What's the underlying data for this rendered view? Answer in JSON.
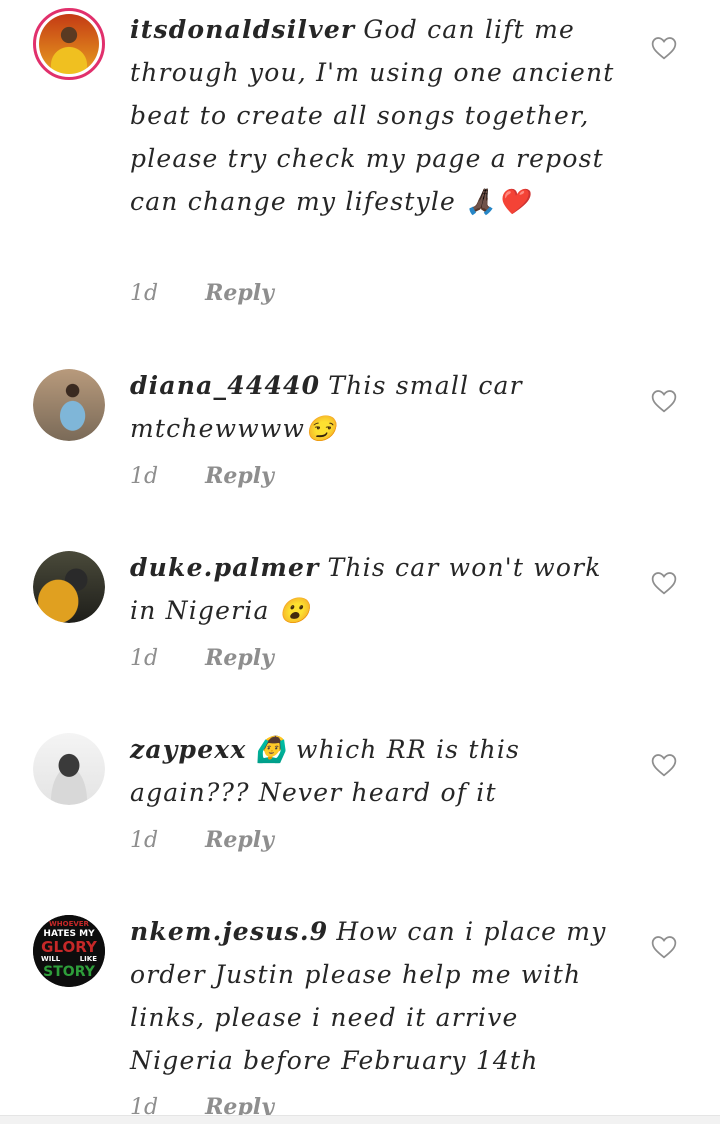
{
  "comments": [
    {
      "username": "itsdonaldsilver",
      "text": "God can lift me through you, I'm using one ancient beat to create all songs together, please try check my page a repost can change my lifestyle 🙏🏿❤️",
      "time": "1d",
      "reply": "Reply"
    },
    {
      "username": "diana_44440",
      "text": "This small car mtchewwww😏",
      "time": "1d",
      "reply": "Reply"
    },
    {
      "username": "duke.palmer",
      "text": "This car won't work in Nigeria 😮",
      "time": "1d",
      "reply": "Reply"
    },
    {
      "username": "zaypexx",
      "text": "🙆‍♂️ which RR is this again??? Never heard of it",
      "time": "1d",
      "reply": "Reply"
    },
    {
      "username": "nkem.jesus.9",
      "text": "How can i place my order Justin please help me with links, please i need it arrive Nigeria before February 14th",
      "time": "1d",
      "reply": "Reply"
    }
  ],
  "avatars": {
    "nkem_text": [
      "WHOEVER",
      "HATES MY",
      "GLORY",
      "WILL",
      "LIKE",
      "STORY"
    ]
  },
  "colors": {
    "ring": "#e1306c",
    "meta": "#8e8e8e",
    "text": "#262626"
  },
  "icons": {
    "like": "heart-outline-icon"
  }
}
